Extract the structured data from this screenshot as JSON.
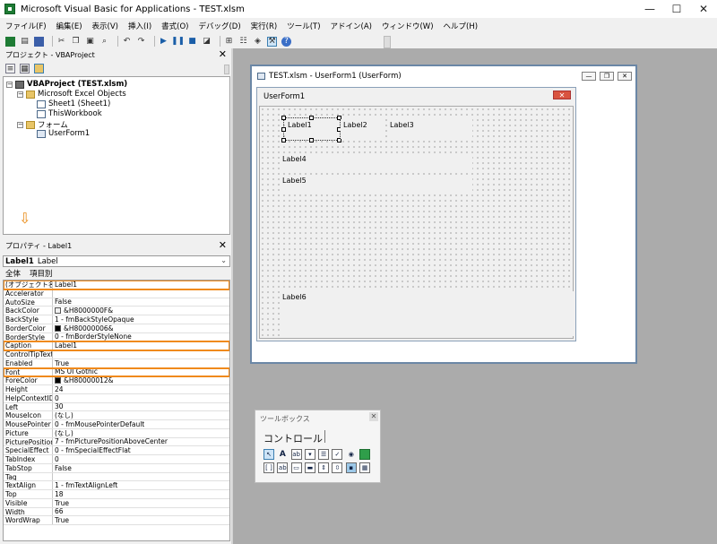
{
  "window": {
    "title": "Microsoft Visual Basic for Applications - TEST.xlsm",
    "minimize": "—",
    "maximize": "☐",
    "close": "✕"
  },
  "menu": [
    "ファイル(F)",
    "編集(E)",
    "表示(V)",
    "挿入(I)",
    "書式(O)",
    "デバッグ(D)",
    "実行(R)",
    "ツール(T)",
    "アドイン(A)",
    "ウィンドウ(W)",
    "ヘルプ(H)"
  ],
  "project_pane": {
    "title": "プロジェクト - VBAProject",
    "close": "✕",
    "tree": {
      "root": "VBAProject (TEST.xlsm)",
      "excel_objects": "Microsoft Excel Objects",
      "sheet1": "Sheet1 (Sheet1)",
      "thisworkbook": "ThisWorkbook",
      "forms": "フォーム",
      "userform1": "UserForm1"
    },
    "arrow": "⇩"
  },
  "properties_pane": {
    "title": "プロパティ - Label1",
    "close": "✕",
    "object_name": "Label1",
    "object_type": "Label",
    "tabs": [
      "全体",
      "項目別"
    ],
    "rows": [
      {
        "name": "(オブジェクト名)",
        "value": "Label1",
        "highlight": true
      },
      {
        "name": "Accelerator",
        "value": ""
      },
      {
        "name": "AutoSize",
        "value": "False"
      },
      {
        "name": "BackColor",
        "value": "&H8000000F&",
        "swatch": "#f0f0f0"
      },
      {
        "name": "BackStyle",
        "value": "1 - fmBackStyleOpaque"
      },
      {
        "name": "BorderColor",
        "value": "&H80000006&",
        "swatch": "#000000"
      },
      {
        "name": "BorderStyle",
        "value": "0 - fmBorderStyleNone"
      },
      {
        "name": "Caption",
        "value": "Label1",
        "highlight": true
      },
      {
        "name": "ControlTipText",
        "value": ""
      },
      {
        "name": "Enabled",
        "value": "True"
      },
      {
        "name": "Font",
        "value": "MS UI Gothic",
        "highlight": true
      },
      {
        "name": "ForeColor",
        "value": "&H80000012&",
        "swatch": "#000000"
      },
      {
        "name": "Height",
        "value": "24"
      },
      {
        "name": "HelpContextID",
        "value": "0"
      },
      {
        "name": "Left",
        "value": "30"
      },
      {
        "name": "MouseIcon",
        "value": "(なし)"
      },
      {
        "name": "MousePointer",
        "value": "0 - fmMousePointerDefault"
      },
      {
        "name": "Picture",
        "value": "(なし)"
      },
      {
        "name": "PicturePosition",
        "value": "7 - fmPicturePositionAboveCenter"
      },
      {
        "name": "SpecialEffect",
        "value": "0 - fmSpecialEffectFlat"
      },
      {
        "name": "TabIndex",
        "value": "0"
      },
      {
        "name": "TabStop",
        "value": "False"
      },
      {
        "name": "Tag",
        "value": ""
      },
      {
        "name": "TextAlign",
        "value": "1 - fmTextAlignLeft"
      },
      {
        "name": "Top",
        "value": "18"
      },
      {
        "name": "Visible",
        "value": "True"
      },
      {
        "name": "Width",
        "value": "66"
      },
      {
        "name": "WordWrap",
        "value": "True"
      }
    ]
  },
  "designer": {
    "title": "TEST.xlsm - UserForm1 (UserForm)",
    "userform_caption": "UserForm1",
    "labels": [
      "Label1",
      "Label2",
      "Label3",
      "Label4",
      "Label5",
      "Label6"
    ]
  },
  "toolbox": {
    "title": "ツールボックス",
    "tab": "コントロール",
    "close": "✕"
  },
  "colors": {
    "highlight": "#f08a1c",
    "workspace": "#ababab"
  }
}
